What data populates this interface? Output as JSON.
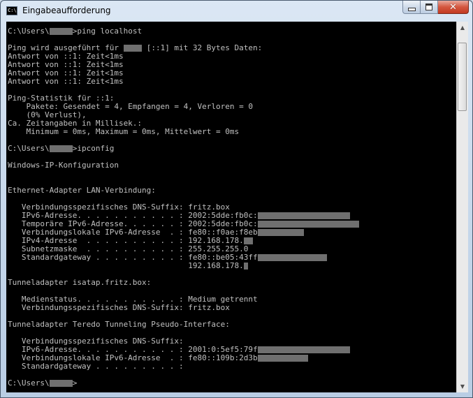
{
  "window": {
    "title": "Eingabeaufforderung",
    "icon": "cmd-icon",
    "buttons": {
      "minimize": "minimize-icon",
      "maximize": "maximize-icon",
      "close": "close-icon"
    }
  },
  "console": {
    "lines": [
      [
        {
          "t": "C:\\Users\\"
        },
        {
          "b": "xxxxx"
        },
        {
          "t": ">ping localhost"
        }
      ],
      [],
      [
        {
          "t": "Ping wird ausgeführt für "
        },
        {
          "b": "xxxx"
        },
        {
          "t": " [::1] mit 32 Bytes Daten:"
        }
      ],
      [
        {
          "t": "Antwort von ::1: Zeit<1ms"
        }
      ],
      [
        {
          "t": "Antwort von ::1: Zeit<1ms"
        }
      ],
      [
        {
          "t": "Antwort von ::1: Zeit<1ms"
        }
      ],
      [
        {
          "t": "Antwort von ::1: Zeit<1ms"
        }
      ],
      [],
      [
        {
          "t": "Ping-Statistik für ::1:"
        }
      ],
      [
        {
          "t": "    Pakete: Gesendet = 4, Empfangen = 4, Verloren = 0"
        }
      ],
      [
        {
          "t": "    (0% Verlust),"
        }
      ],
      [
        {
          "t": "Ca. Zeitangaben in Millisek.:"
        }
      ],
      [
        {
          "t": "    Minimum = 0ms, Maximum = 0ms, Mittelwert = 0ms"
        }
      ],
      [],
      [
        {
          "t": "C:\\Users\\"
        },
        {
          "b": "xxxxx"
        },
        {
          "t": ">ipconfig"
        }
      ],
      [],
      [
        {
          "t": "Windows-IP-Konfiguration"
        }
      ],
      [],
      [],
      [
        {
          "t": "Ethernet-Adapter LAN-Verbindung:"
        }
      ],
      [],
      [
        {
          "t": "   Verbindungsspezifisches DNS-Suffix: fritz.box"
        }
      ],
      [
        {
          "t": "   IPv6-Adresse. . . . . . . . . . . : 2002:5dde:fb0c:"
        },
        {
          "b": "xxxxxxxxxxxxxxxxxxxx"
        }
      ],
      [
        {
          "t": "   Temporäre IPv6-Adresse. . . . . . : 2002:5dde:fb0c:"
        },
        {
          "b": "xxxxxxxxxxxxxxxxxxxxxx"
        }
      ],
      [
        {
          "t": "   Verbindungslokale IPv6-Adresse  . : fe80::f0ae:f8eb"
        },
        {
          "b": "xxxxxxxxxx"
        }
      ],
      [
        {
          "t": "   IPv4-Adresse  . . . . . . . . . . : 192.168.178."
        },
        {
          "b": "xx"
        }
      ],
      [
        {
          "t": "   Subnetzmaske  . . . . . . . . . . : 255.255.255.0"
        }
      ],
      [
        {
          "t": "   Standardgateway . . . . . . . . . : fe80::be05:43ff"
        },
        {
          "b": "xxxxxxxxxxxxxxx"
        }
      ],
      [
        {
          "t": "                                       192.168.178."
        },
        {
          "b": "x"
        }
      ],
      [],
      [
        {
          "t": "Tunneladapter isatap.fritz.box:"
        }
      ],
      [],
      [
        {
          "t": "   Medienstatus. . . . . . . . . . . : Medium getrennt"
        }
      ],
      [
        {
          "t": "   Verbindungsspezifisches DNS-Suffix: fritz.box"
        }
      ],
      [],
      [
        {
          "t": "Tunneladapter Teredo Tunneling Pseudo-Interface:"
        }
      ],
      [],
      [
        {
          "t": "   Verbindungsspezifisches DNS-Suffix:"
        }
      ],
      [
        {
          "t": "   IPv6-Adresse. . . . . . . . . . . : 2001:0:5ef5:79f"
        },
        {
          "b": "xxxxxxxxxxxxxxxxxxxx"
        }
      ],
      [
        {
          "t": "   Verbindungslokale IPv6-Adresse  . : fe80::109b:2d3b"
        },
        {
          "b": "xxxxxxxxxxx"
        }
      ],
      [
        {
          "t": "   Standardgateway . . . . . . . . . :"
        }
      ],
      [],
      [
        {
          "t": "C:\\Users\\"
        },
        {
          "b": "xxxxx"
        },
        {
          "t": ">"
        }
      ]
    ]
  },
  "scrollbar": {
    "up": "scroll-up-arrow-icon",
    "down": "scroll-down-arrow-icon"
  }
}
